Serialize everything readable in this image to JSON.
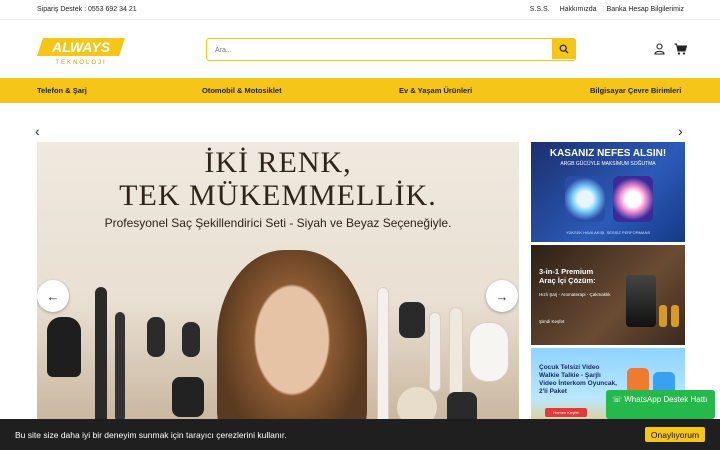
{
  "topbar": {
    "support": "Sipariş Destek : 0553 692 34 21",
    "links": [
      "S.S.S.",
      "Hakkımızda",
      "Banka Hesap Bilgilerimiz"
    ]
  },
  "header": {
    "logo_main": "ALWAYS",
    "logo_sub": "TEKNOLOJİ",
    "search_placeholder": "Ara...",
    "icons": [
      "user-icon",
      "cart-icon"
    ]
  },
  "nav": {
    "items": [
      "Telefon & Şarj",
      "Otomobil & Motosiklet",
      "Ev & Yaşam Ürünleri",
      "Bilgisayar Çevre Birimleri"
    ]
  },
  "hero": {
    "title_line1": "İKİ RENK,",
    "title_line2": "TEK MÜKEMMELLİK.",
    "subtitle": "Profesyonel Saç Şekillendirici Seti - Siyah ve Beyaz Seçeneğiyle."
  },
  "side_banners": [
    {
      "title": "KASANIZ NEFES ALSIN!",
      "subtitle": "ARGB GÜCÜYLE MAKSİMUM SOĞUTMA",
      "caption": "YÜKSEK HAVA AKIŞI, SESSİZ PERFORMANS"
    },
    {
      "title": "3-in-1 Premium Araç İçi Çözüm:",
      "subtitle": "Hızlı Şarj - Aromaterapi - Çakmaklık",
      "caption": "Şimdi Keşfet"
    },
    {
      "title": "Çocuk Telsizi Video Walkie Talkie - Şarjlı Video İnterkom Oyuncak, 2'li Paket",
      "caption": "Hemen Keşfet"
    }
  ],
  "whatsapp": {
    "label": "WhatsApp Destek Hattı"
  },
  "cookie": {
    "text": "Bu site size daha iyi bir deneyim sunmak için tarayıcı çerezlerini kullanır.",
    "accept": "Onaylıyorum"
  },
  "colors": {
    "accent": "#f5c518",
    "whatsapp": "#25b84a",
    "cookie_bg": "#1f1f1f"
  }
}
